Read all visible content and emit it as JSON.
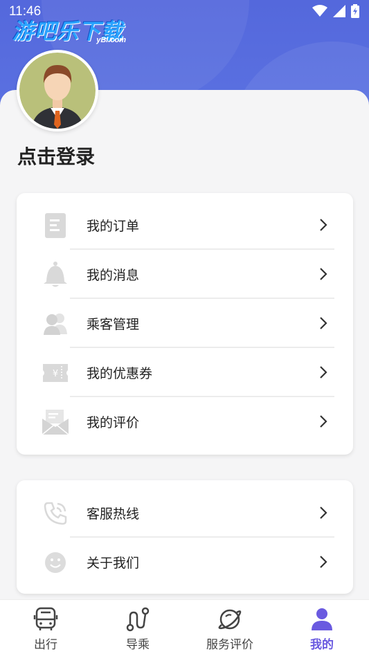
{
  "status_bar": {
    "time": "11:46"
  },
  "watermark": {
    "text": "游吧乐下载",
    "sub": "yBl.com"
  },
  "profile": {
    "login_prompt": "点击登录"
  },
  "menu_main": [
    {
      "label": "我的订单",
      "icon": "order-document-icon"
    },
    {
      "label": "我的消息",
      "icon": "bell-icon"
    },
    {
      "label": "乘客管理",
      "icon": "passengers-icon"
    },
    {
      "label": "我的优惠券",
      "icon": "coupon-icon"
    },
    {
      "label": "我的评价",
      "icon": "review-envelope-icon"
    }
  ],
  "menu_support": [
    {
      "label": "客服热线",
      "icon": "phone-icon"
    },
    {
      "label": "关于我们",
      "icon": "smiley-icon"
    }
  ],
  "tabbar": {
    "tabs": [
      {
        "label": "出行",
        "icon": "bus-icon",
        "active": false
      },
      {
        "label": "导乘",
        "icon": "route-icon",
        "active": false
      },
      {
        "label": "服务评价",
        "icon": "planet-icon",
        "active": false
      },
      {
        "label": "我的",
        "icon": "user-icon",
        "active": true
      }
    ],
    "active_color": "#6a5ae0",
    "inactive_color": "#444444"
  },
  "colors": {
    "header": "#5468dc",
    "icon_gray": "#d9d9d9",
    "text": "#222222"
  }
}
